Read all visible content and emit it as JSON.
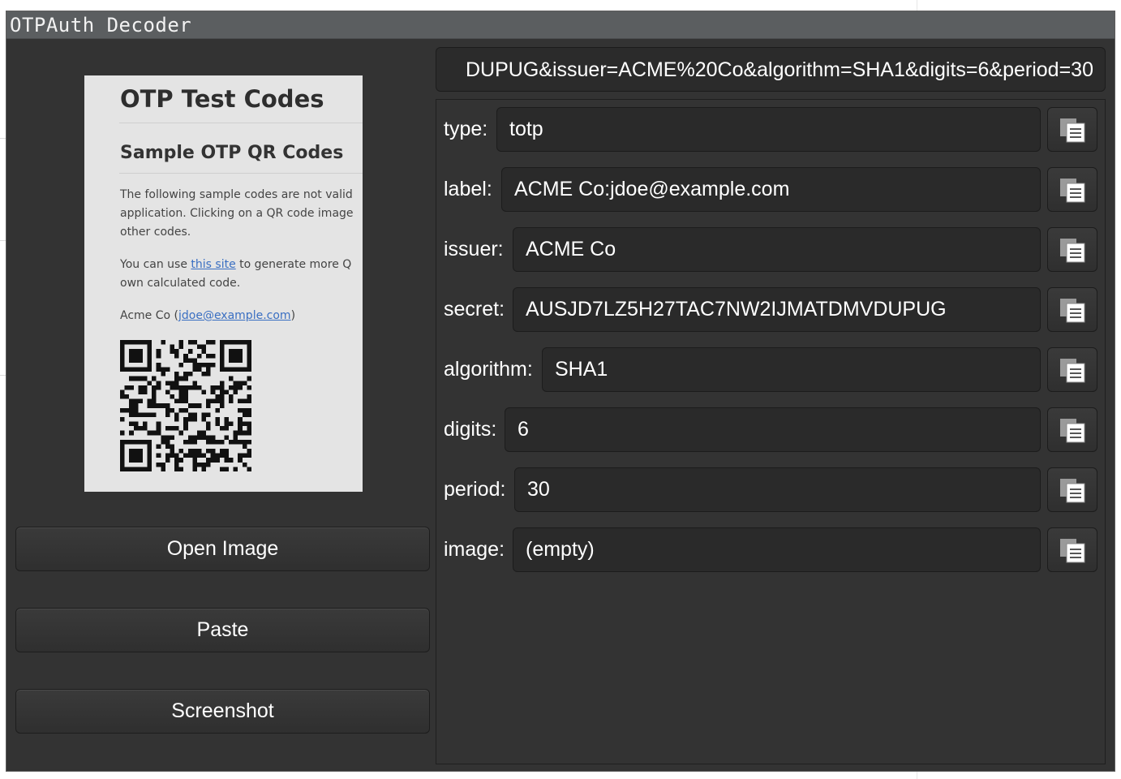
{
  "window": {
    "title": "OTPAuth Decoder"
  },
  "preview": {
    "heading": "OTP Test Codes",
    "subheading": "Sample OTP QR Codes",
    "para1_line1": "The following sample codes are not valid",
    "para1_line2": "application. Clicking on a QR code image",
    "para1_line3": "other codes.",
    "para2_prefix": "You can use ",
    "para2_link": "this site",
    "para2_suffix": " to generate more Q",
    "para2_line2": "own calculated code.",
    "account_prefix": "Acme Co (",
    "account_link": "jdoe@example.com",
    "account_suffix": ")"
  },
  "actions": {
    "open_image": "Open Image",
    "paste": "Paste",
    "screenshot": "Screenshot"
  },
  "uri": {
    "visible_text": "DUPUG&issuer=ACME%20Co&algorithm=SHA1&digits=6&period=30"
  },
  "fields": [
    {
      "label": "type:",
      "value": "totp"
    },
    {
      "label": "label:",
      "value": "ACME Co:jdoe@example.com"
    },
    {
      "label": "issuer:",
      "value": "ACME Co"
    },
    {
      "label": "secret:",
      "value": "AUSJD7LZ5H27TAC7NW2IJMATDMVDUPUG"
    },
    {
      "label": "algorithm:",
      "value": "SHA1"
    },
    {
      "label": "digits:",
      "value": "6"
    },
    {
      "label": "period:",
      "value": "30"
    },
    {
      "label": "image:",
      "value": "(empty)"
    }
  ],
  "icons": {
    "copy": "copy-icon"
  },
  "colors": {
    "window_bg": "#333333",
    "titlebar_bg": "#5b5e60",
    "field_bg": "#2a2a2a",
    "text": "#ffffff",
    "link": "#3a6fc2"
  }
}
